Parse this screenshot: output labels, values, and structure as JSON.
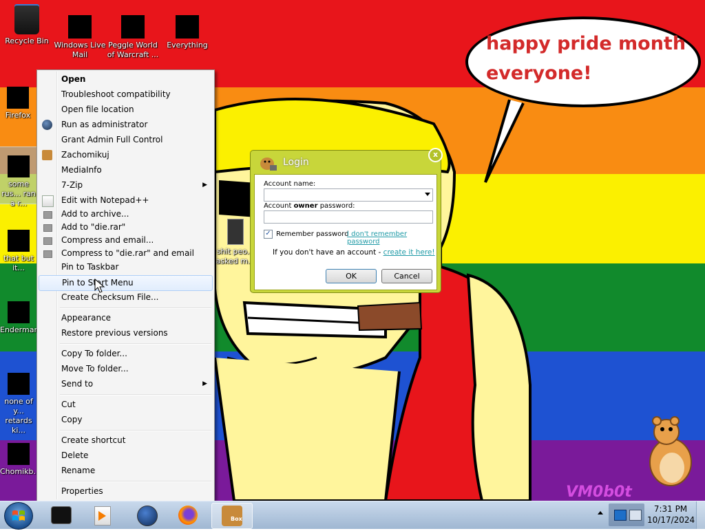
{
  "desktop": {
    "icons": [
      {
        "label": "Recycle Bin"
      },
      {
        "label": "Windows Live Mail"
      },
      {
        "label": "Peggle World of Warcraft ..."
      },
      {
        "label": "Everything"
      },
      {
        "label": "Firefox"
      },
      {
        "label": "some rus... ran a r..."
      },
      {
        "label": "that but it..."
      },
      {
        "label": "Enderman..."
      },
      {
        "label": "none of y... retards ki..."
      },
      {
        "label": "Chomikb..."
      },
      {
        "label": "shit peo... asked m..."
      }
    ],
    "bubble_text_line1": "happy pride month",
    "bubble_text_line2": "everyone!",
    "signature": "VM0b0t",
    "colors": {
      "red": "#e8151b",
      "orange": "#f98c12",
      "yellow": "#fbf000",
      "green": "#118a2c",
      "blue": "#1e52d2",
      "purple": "#7a1a9a"
    }
  },
  "context_menu": {
    "items": [
      {
        "label": "Open",
        "bold": true
      },
      {
        "label": "Troubleshoot compatibility"
      },
      {
        "label": "Open file location"
      },
      {
        "label": "Run as administrator",
        "icon": "shield-icon"
      },
      {
        "label": "Grant Admin Full Control"
      },
      {
        "label": "Zachomikuj",
        "icon": "hamster-icon"
      },
      {
        "label": "MediaInfo"
      },
      {
        "label": "7-Zip",
        "submenu": true
      },
      {
        "label": "Edit with Notepad++",
        "icon": "notepad-icon"
      },
      {
        "label": "Add to archive...",
        "icon": "archive-icon"
      },
      {
        "label": "Add to \"die.rar\"",
        "icon": "archive-icon"
      },
      {
        "label": "Compress and email...",
        "icon": "archive-icon"
      },
      {
        "label": "Compress to \"die.rar\" and email",
        "icon": "archive-icon"
      },
      {
        "label": "Pin to Taskbar"
      },
      {
        "label": "Pin to Start Menu",
        "hover": true
      },
      {
        "label": "Create Checksum File..."
      },
      {
        "label": "Appearance"
      },
      {
        "label": "Restore previous versions"
      },
      {
        "label": "Copy To folder..."
      },
      {
        "label": "Move To folder..."
      },
      {
        "label": "Send to",
        "submenu": true
      },
      {
        "label": "Cut"
      },
      {
        "label": "Copy"
      },
      {
        "label": "Create shortcut"
      },
      {
        "label": "Delete"
      },
      {
        "label": "Rename"
      },
      {
        "label": "Properties"
      }
    ]
  },
  "login": {
    "title": "Login",
    "account_name_label": "Account name:",
    "account_name_value": "",
    "password_label_pre": "Account ",
    "password_label_bold": "owner",
    "password_label_post": " password:",
    "password_value": "",
    "remember_label": "Remember password",
    "remember_checked": true,
    "forgot_link": "I don't remember password",
    "no_account_text": "If you don't have an account - ",
    "create_link": "create it here!",
    "ok_label": "OK",
    "cancel_label": "Cancel",
    "close_label": "x"
  },
  "taskbar": {
    "clock_time": "7:31 PM",
    "clock_date": "10/17/2024",
    "active_app_label": "Box"
  }
}
